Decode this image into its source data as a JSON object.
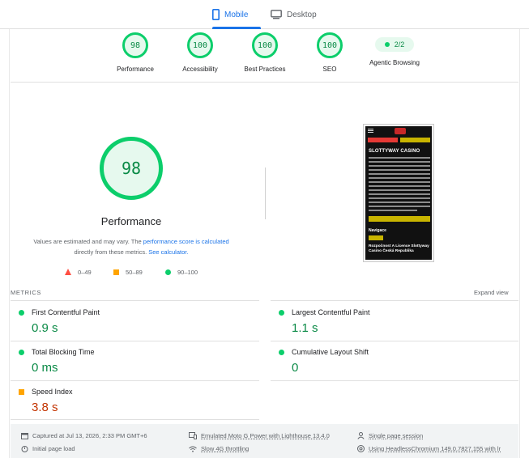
{
  "tabs": {
    "mobile": "Mobile",
    "desktop": "Desktop"
  },
  "categories": [
    {
      "score": "98",
      "label": "Performance"
    },
    {
      "score": "100",
      "label": "Accessibility"
    },
    {
      "score": "100",
      "label": "Best Practices"
    },
    {
      "score": "100",
      "label": "SEO"
    }
  ],
  "agentic": {
    "value": "2/2",
    "label": "Agentic Browsing"
  },
  "performance": {
    "score": "98",
    "title": "Performance",
    "note_prefix": "Values are estimated and may vary. The ",
    "note_link1": "performance score is calculated",
    "note_middle": " directly from these metrics. ",
    "note_link2": "See calculator."
  },
  "legend": {
    "poor": "0–49",
    "average": "50–89",
    "good": "90–100"
  },
  "screenshot": {
    "button_left": "PRIHLÁSENIE",
    "button_right": "REGISTRÁCIA",
    "title": "SLOTTYWAY CASINO",
    "nav_label": "Navigace",
    "footer_text": "Rozpočnost A Licence Slottyway Casino Česká Republika"
  },
  "metrics": {
    "title": "METRICS",
    "expand": "Expand view",
    "fcp": {
      "label": "First Contentful Paint",
      "value": "0.9 s",
      "status": "good"
    },
    "lcp": {
      "label": "Largest Contentful Paint",
      "value": "1.1 s",
      "status": "good"
    },
    "tbt": {
      "label": "Total Blocking Time",
      "value": "0 ms",
      "status": "good"
    },
    "cls": {
      "label": "Cumulative Layout Shift",
      "value": "0",
      "status": "good"
    },
    "si": {
      "label": "Speed Index",
      "value": "3.8 s",
      "status": "average"
    }
  },
  "info": {
    "captured": "Captured at Jul 13, 2026, 2:33 PM GMT+6",
    "load": "Initial page load",
    "device": "Emulated Moto G Power with Lighthouse 13.4.0",
    "throttling": "Slow 4G throttling",
    "session": "Single page session",
    "browser": "Using HeadlessChromium 149.0.7827.155 with lr"
  },
  "colors": {
    "good": "#0cce6b",
    "average": "#ffa400",
    "poor": "#ff4e42",
    "accent": "#1a73e8"
  }
}
